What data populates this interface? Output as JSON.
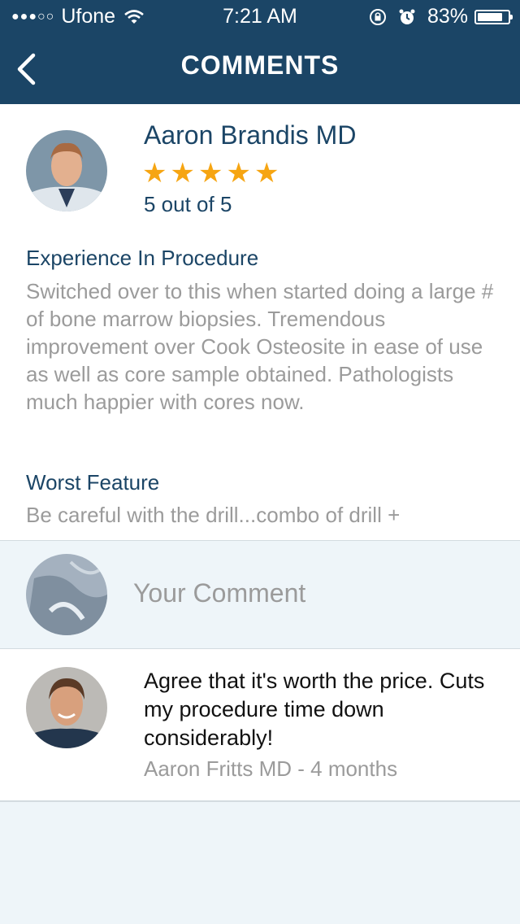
{
  "status_bar": {
    "carrier": "Ufone",
    "time": "7:21 AM",
    "battery": "83%",
    "battery_level": 0.83,
    "signal_dots": "●●●○○"
  },
  "header": {
    "title": "COMMENTS",
    "back_icon": "chevron-left-icon",
    "background": "#1b4566"
  },
  "review": {
    "name": "Aaron Brandis MD",
    "rating": 5,
    "rating_max": 5,
    "rating_text": "5 out of 5",
    "star_color": "#f6a512",
    "sections": [
      {
        "heading": "Experience In Procedure",
        "text": "Switched over to this when started doing a large # of bone marrow biopsies. Tremendous improvement over Cook Osteosite in ease of use as well as core sample obtained. Pathologists much happier with cores now."
      },
      {
        "heading": "Worst Feature",
        "text": "Be careful with the drill...combo of drill +"
      }
    ]
  },
  "comment_input": {
    "placeholder": "Your Comment"
  },
  "comments": [
    {
      "text": "Agree that it's worth the price. Cuts my procedure time down considerably!",
      "meta": "Aaron Fritts MD - 4 months"
    }
  ]
}
